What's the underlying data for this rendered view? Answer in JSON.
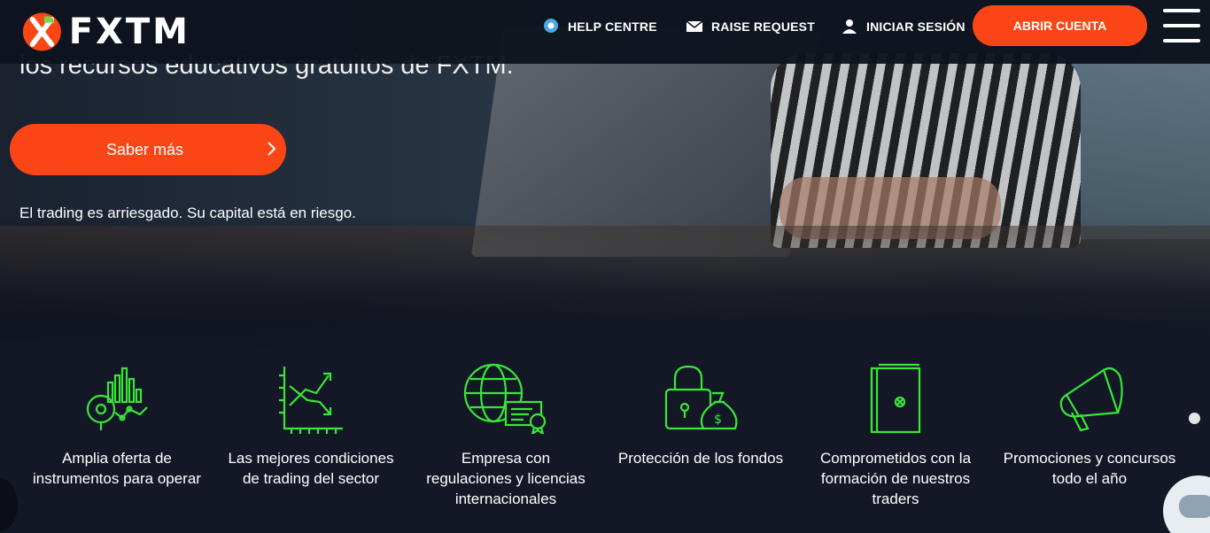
{
  "header": {
    "logo_text": "FXTM",
    "nav": {
      "help": "HELP CENTRE",
      "request": "RAISE REQUEST",
      "login": "INICIAR SESIÓN"
    },
    "cta": "ABRIR CUENTA"
  },
  "hero": {
    "partial_line": "los recursos educativos gratuitos de FXTM.",
    "button": "Saber más",
    "risk_notice": "El trading es arriesgado. Su capital está en riesgo."
  },
  "features": [
    {
      "label": "Amplia oferta de instrumentos para operar",
      "icon": "chart-analytics-icon"
    },
    {
      "label": "Las mejores condiciones de trading del sector",
      "icon": "trend-graph-icon"
    },
    {
      "label": "Empresa con regulaciones y licencias internacionales",
      "icon": "globe-certificate-icon"
    },
    {
      "label": "Protección de los fondos",
      "icon": "padlock-moneybag-icon"
    },
    {
      "label": "Comprometidos con la formación de nuestros traders",
      "icon": "book-icon"
    },
    {
      "label": "Promociones y concursos todo el año",
      "icon": "megaphone-icon"
    }
  ],
  "colors": {
    "accent": "#fa4616",
    "icon_green": "#39e639",
    "header_bg": "#0e141e"
  }
}
